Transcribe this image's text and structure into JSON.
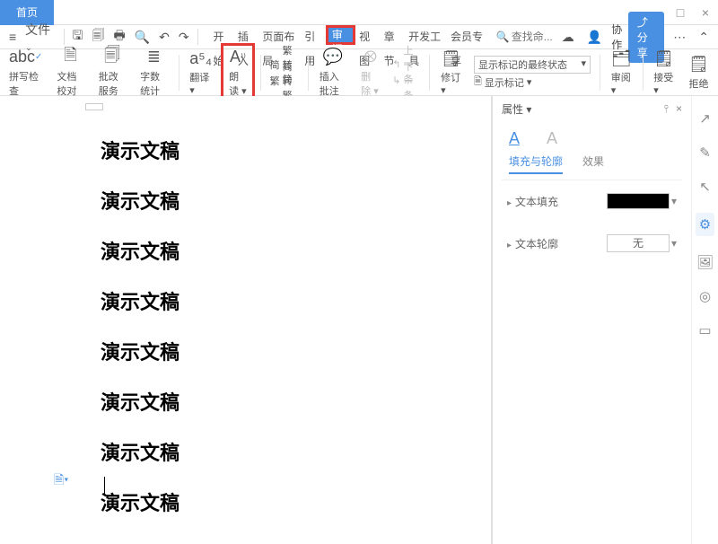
{
  "title_tab": "首页",
  "window_controls": {
    "min": "−",
    "max": "□",
    "close": "×"
  },
  "file_menu": "文件",
  "menu_tabs": [
    "开始",
    "插入",
    "页面布局",
    "引用",
    "审阅",
    "视图",
    "章节",
    "开发工具",
    "会员专享"
  ],
  "highlighted_tab_index": 4,
  "search_placeholder": "查找命...",
  "collaborate_label": "协作",
  "share_label": "分享",
  "ribbon": {
    "spell": "拼写检查",
    "proof": "文档校对",
    "bulk": "批改服务",
    "wordcount": "字数统计",
    "translate": "翻译",
    "read_aloud": "朗读",
    "convert_trad": "繁转简",
    "convert_simp": "简转繁",
    "insert_comment": "插入批注",
    "delete": "删除",
    "prev": "上一条",
    "next": "下一条",
    "revise": "修订",
    "markup_dropdown": "显示标记的最终状态",
    "show_markup": "显示标记",
    "review": "审阅",
    "accept": "接受",
    "reject": "拒绝"
  },
  "highlighted_ribbon": "朗读",
  "document_lines": [
    "演示文稿",
    "演示文稿",
    "演示文稿",
    "演示文稿",
    "演示文稿",
    "演示文稿",
    "演示文稿",
    "演示文稿"
  ],
  "side_panel": {
    "title": "属性",
    "tab_fill": "填充与轮廓",
    "tab_effect": "效果",
    "row_fill": "文本填充",
    "row_outline": "文本轮廓",
    "outline_value": "无"
  }
}
